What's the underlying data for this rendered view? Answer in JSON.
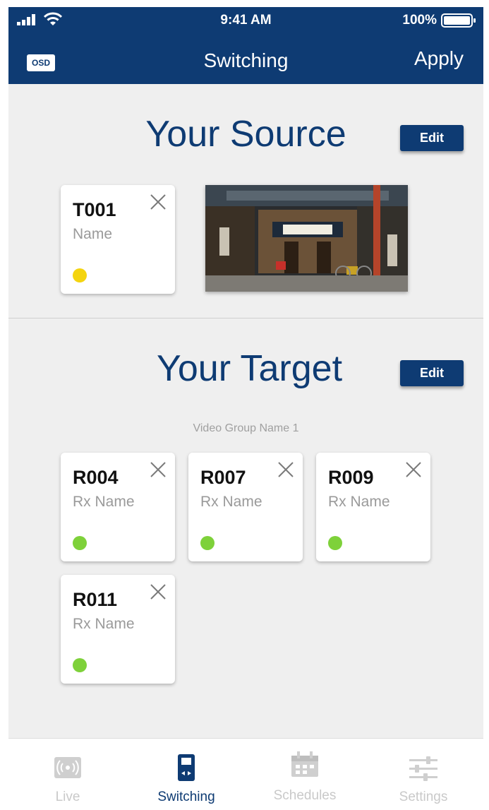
{
  "status_bar": {
    "time": "9:41 AM",
    "battery": "100%"
  },
  "nav": {
    "osd_label": "OSD",
    "title": "Switching",
    "apply_label": "Apply"
  },
  "source": {
    "title": "Your Source",
    "edit_label": "Edit",
    "card": {
      "id": "T001",
      "name": "Name",
      "status_color": "#f4d40f"
    }
  },
  "target": {
    "title": "Your Target",
    "edit_label": "Edit",
    "group_name": "Video Group Name 1",
    "cards": [
      {
        "id": "R004",
        "name": "Rx Name",
        "status_color": "#7ed13a"
      },
      {
        "id": "R007",
        "name": "Rx Name",
        "status_color": "#7ed13a"
      },
      {
        "id": "R009",
        "name": "Rx Name",
        "status_color": "#7ed13a"
      },
      {
        "id": "R011",
        "name": "Rx Name",
        "status_color": "#7ed13a"
      }
    ]
  },
  "tabs": [
    {
      "label": "Live",
      "icon": "live-broadcast-icon",
      "active": false
    },
    {
      "label": "Switching",
      "icon": "switching-icon",
      "active": true
    },
    {
      "label": "Schedules",
      "icon": "calendar-icon",
      "active": false
    },
    {
      "label": "Settings",
      "icon": "sliders-icon",
      "active": false
    }
  ],
  "colors": {
    "brand": "#0e3b73",
    "inactive_tab": "#c9c9c9",
    "background": "#efefef"
  }
}
